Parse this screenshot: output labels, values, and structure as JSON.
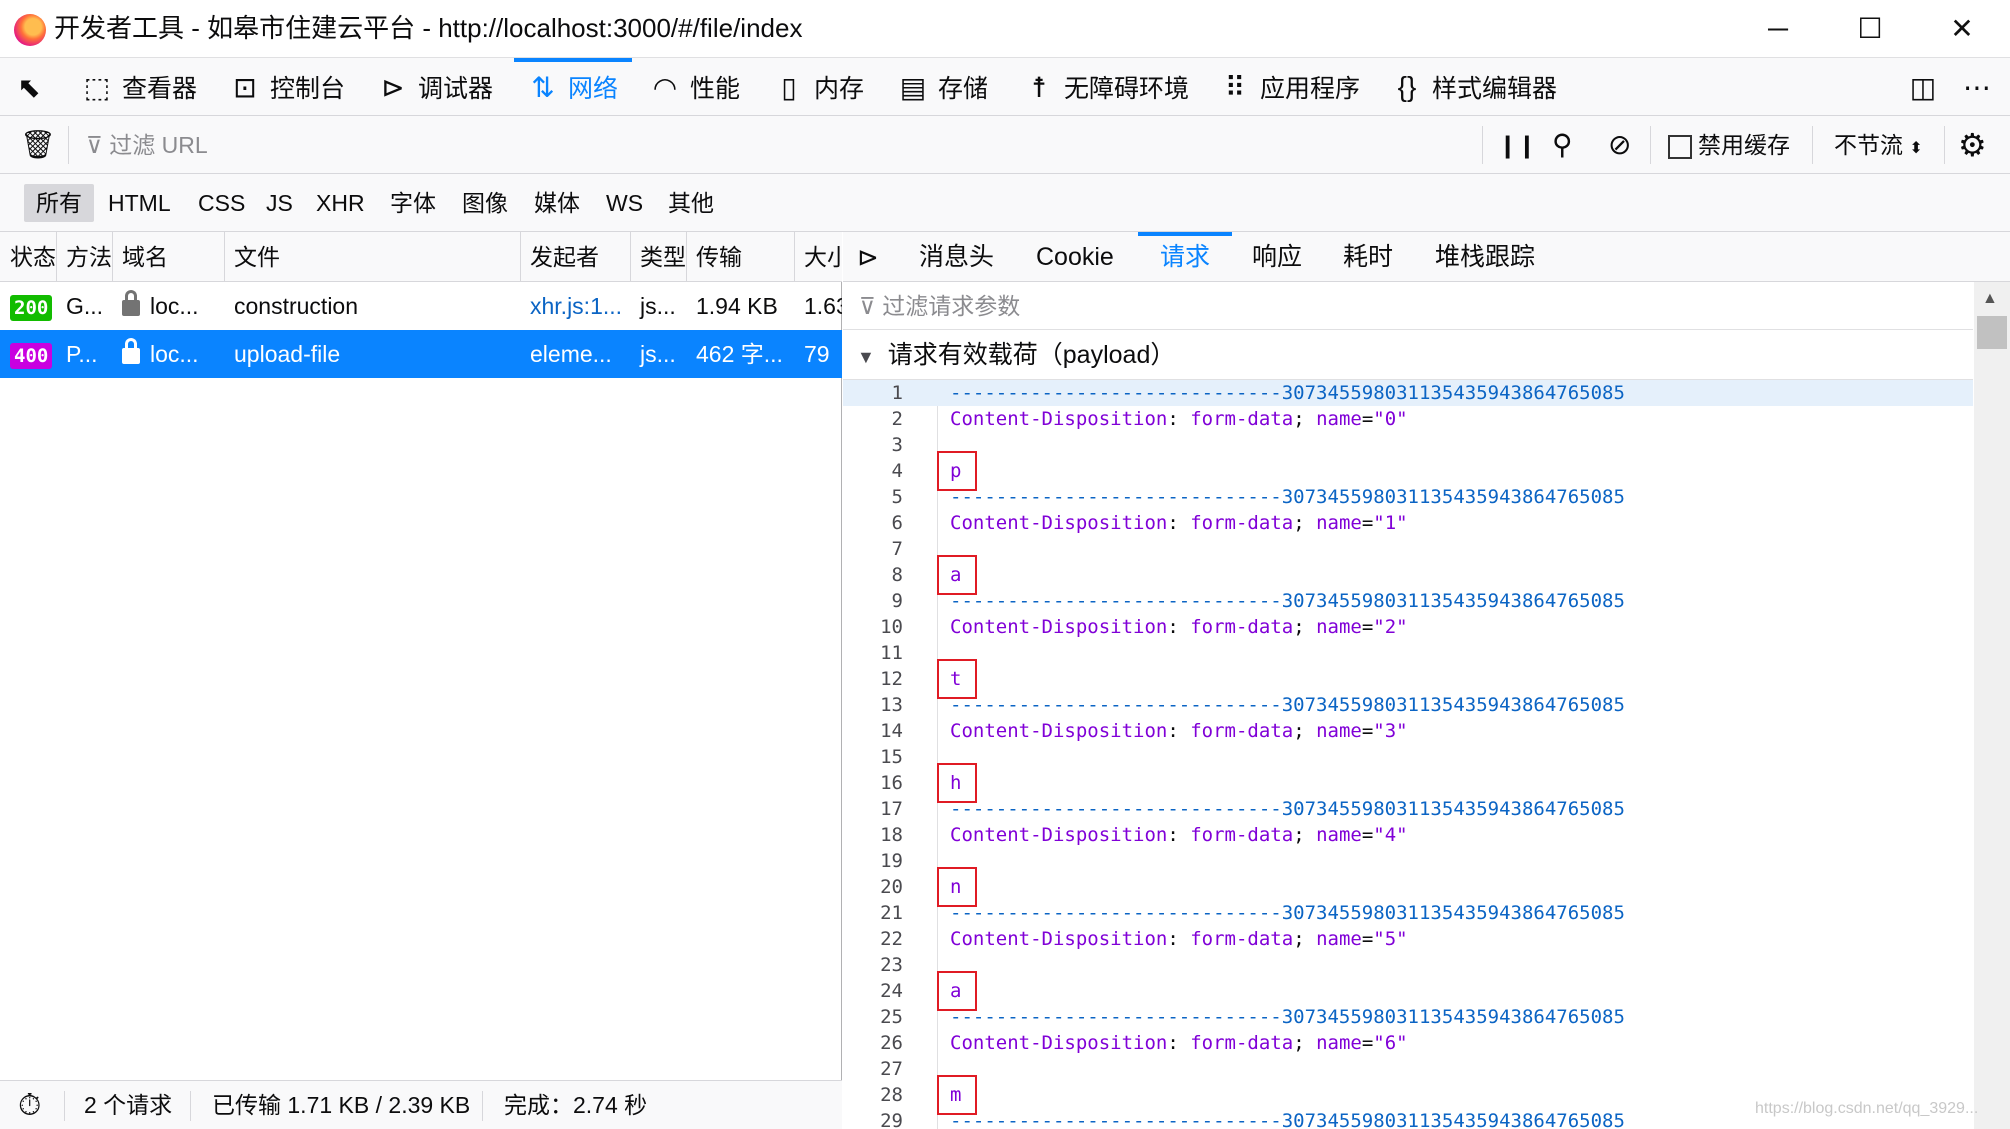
{
  "window": {
    "title": "开发者工具 - 如皋市住建云平台 - http://localhost:3000/#/file/index",
    "minimize": "─",
    "maximize": "☐",
    "close": "✕"
  },
  "toolbox": {
    "tabs": [
      {
        "label": "查看器",
        "icon": "inspector-icon"
      },
      {
        "label": "控制台",
        "icon": "console-icon"
      },
      {
        "label": "调试器",
        "icon": "debugger-icon"
      },
      {
        "label": "网络",
        "icon": "network-icon",
        "active": true
      },
      {
        "label": "性能",
        "icon": "performance-icon"
      },
      {
        "label": "内存",
        "icon": "memory-icon"
      },
      {
        "label": "存储",
        "icon": "storage-icon"
      },
      {
        "label": "无障碍环境",
        "icon": "accessibility-icon"
      },
      {
        "label": "应用程序",
        "icon": "application-icon"
      },
      {
        "label": "样式编辑器",
        "icon": "style-editor-icon"
      }
    ],
    "accent": "#0a84ff"
  },
  "nettoolbar": {
    "filter_placeholder": "过滤 URL",
    "disable_cache": "禁用缓存",
    "throttle": "不节流"
  },
  "type_filters": [
    "所有",
    "HTML",
    "CSS",
    "JS",
    "XHR",
    "字体",
    "图像",
    "媒体",
    "WS",
    "其他"
  ],
  "request_list": {
    "headers": [
      "状态",
      "方法",
      "域名",
      "文件",
      "发起者",
      "类型",
      "传输",
      "大小"
    ],
    "rows": [
      {
        "status": "200",
        "method": "G...",
        "domain": "loc...",
        "file": "construction",
        "initiator": "xhr.js:1...",
        "type": "js...",
        "transferred": "1.94 KB",
        "size": "1.63",
        "status_color": "#12bc00"
      },
      {
        "status": "400",
        "method": "P...",
        "domain": "loc...",
        "file": "upload-file",
        "initiator": "eleme...",
        "type": "js...",
        "transferred": "462 字...",
        "size": "79",
        "status_color": "#c900e0",
        "selected": true
      }
    ]
  },
  "statusbar": {
    "requests": "2 个请求",
    "transferred": "已传输 1.71 KB / 2.39 KB",
    "finish": "完成：2.74 秒"
  },
  "details": {
    "tabs": [
      "消息头",
      "Cookie",
      "请求",
      "响应",
      "耗时",
      "堆栈跟踪"
    ],
    "active_tab": "请求",
    "param_filter_placeholder": "过滤请求参数",
    "payload_title": "请求有效载荷（payload）"
  },
  "code_lines": [
    {
      "n": "1",
      "text": "-----------------------------307345598031135435943864765085",
      "kind": "boundary"
    },
    {
      "n": "2",
      "text": "Content-Disposition: form-data; name=\"0\"",
      "kind": "header"
    },
    {
      "n": "3",
      "text": "",
      "kind": "blank"
    },
    {
      "n": "4",
      "text": "p",
      "kind": "value"
    },
    {
      "n": "5",
      "text": "-----------------------------307345598031135435943864765085",
      "kind": "boundary"
    },
    {
      "n": "6",
      "text": "Content-Disposition: form-data; name=\"1\"",
      "kind": "header"
    },
    {
      "n": "7",
      "text": "",
      "kind": "blank"
    },
    {
      "n": "8",
      "text": "a",
      "kind": "value"
    },
    {
      "n": "9",
      "text": "-----------------------------307345598031135435943864765085",
      "kind": "boundary"
    },
    {
      "n": "10",
      "text": "Content-Disposition: form-data; name=\"2\"",
      "kind": "header"
    },
    {
      "n": "11",
      "text": "",
      "kind": "blank"
    },
    {
      "n": "12",
      "text": "t",
      "kind": "value"
    },
    {
      "n": "13",
      "text": "-----------------------------307345598031135435943864765085",
      "kind": "boundary"
    },
    {
      "n": "14",
      "text": "Content-Disposition: form-data; name=\"3\"",
      "kind": "header"
    },
    {
      "n": "15",
      "text": "",
      "kind": "blank"
    },
    {
      "n": "16",
      "text": "h",
      "kind": "value"
    },
    {
      "n": "17",
      "text": "-----------------------------307345598031135435943864765085",
      "kind": "boundary"
    },
    {
      "n": "18",
      "text": "Content-Disposition: form-data; name=\"4\"",
      "kind": "header"
    },
    {
      "n": "19",
      "text": "",
      "kind": "blank"
    },
    {
      "n": "20",
      "text": "n",
      "kind": "value"
    },
    {
      "n": "21",
      "text": "-----------------------------307345598031135435943864765085",
      "kind": "boundary"
    },
    {
      "n": "22",
      "text": "Content-Disposition: form-data; name=\"5\"",
      "kind": "header"
    },
    {
      "n": "23",
      "text": "",
      "kind": "blank"
    },
    {
      "n": "24",
      "text": "a",
      "kind": "value"
    },
    {
      "n": "25",
      "text": "-----------------------------307345598031135435943864765085",
      "kind": "boundary"
    },
    {
      "n": "26",
      "text": "Content-Disposition: form-data; name=\"6\"",
      "kind": "header"
    },
    {
      "n": "27",
      "text": "",
      "kind": "blank"
    },
    {
      "n": "28",
      "text": "m",
      "kind": "value"
    },
    {
      "n": "29",
      "text": "-----------------------------307345598031135435943864765085",
      "kind": "boundary"
    }
  ],
  "watermark": "https://blog.csdn.net/qq_3929..."
}
